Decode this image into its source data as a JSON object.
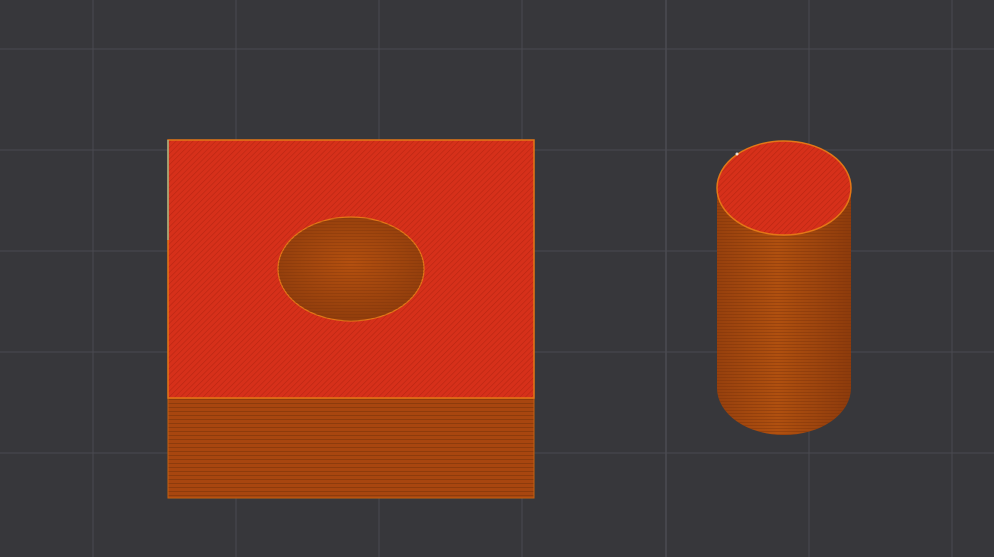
{
  "viewport": {
    "background_color": "#37373b",
    "grid_line_color": "#4a4a50",
    "grid_major_line_color": "#55555c"
  },
  "objects": [
    {
      "name": "block-with-hole",
      "top_color": "#d6301a",
      "side_color": "#a8460f",
      "edge_color": "#e37716",
      "hole_color": "#a44712"
    },
    {
      "name": "cylinder",
      "top_color": "#d8321a",
      "side_color": "#a8460f",
      "edge_color": "#e37716"
    }
  ]
}
